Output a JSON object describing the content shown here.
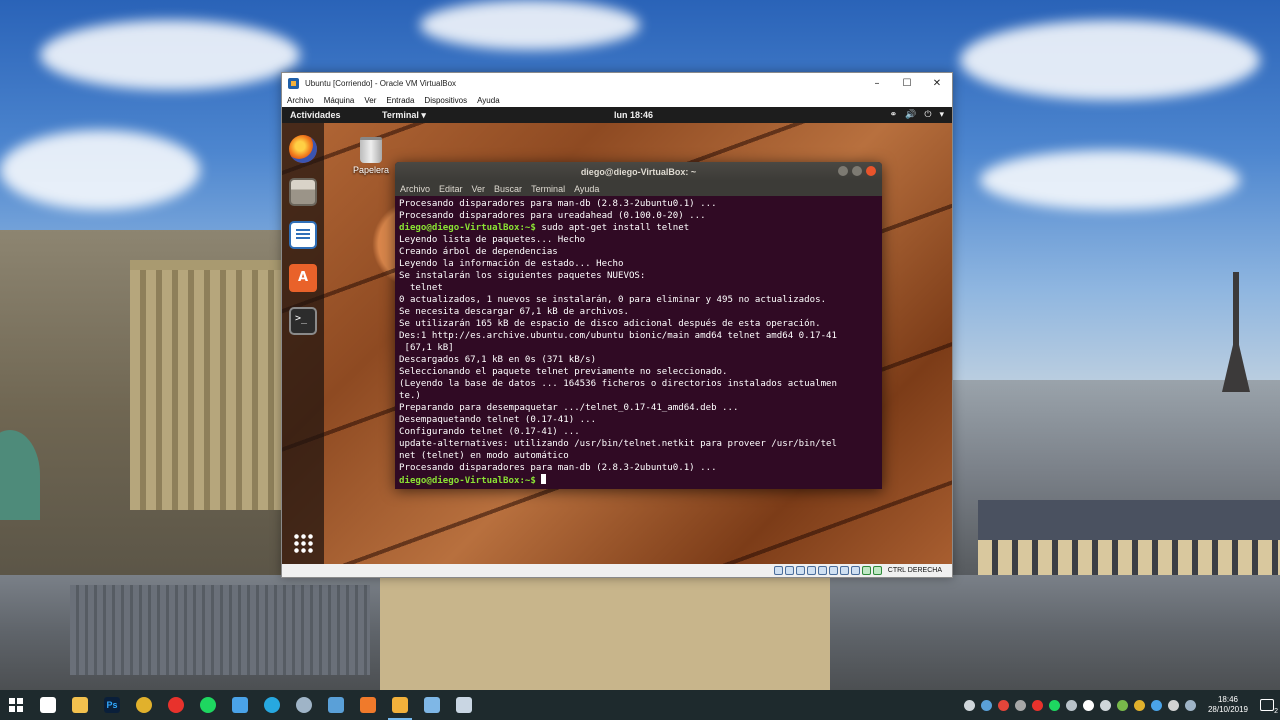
{
  "vbox": {
    "title": "Ubuntu [Corriendo] - Oracle VM VirtualBox",
    "minimize": "–",
    "maximize": "☐",
    "close": "✕",
    "menu": [
      "Archivo",
      "Máquina",
      "Ver",
      "Entrada",
      "Dispositivos",
      "Ayuda"
    ],
    "host_key": "CTRL DERECHA"
  },
  "ubuntu": {
    "activities": "Actividades",
    "app_menu": "Terminal ▾",
    "clock": "lun 18:46",
    "tray": [
      "⚭",
      "🔊",
      "⏻",
      "▾"
    ],
    "trash_label": "Papelera"
  },
  "terminal": {
    "title": "diego@diego-VirtualBox: ~",
    "menu": [
      "Archivo",
      "Editar",
      "Ver",
      "Buscar",
      "Terminal",
      "Ayuda"
    ],
    "prompt": "diego@diego-VirtualBox:~$",
    "lines": [
      {
        "text": "Procesando disparadores para man-db (2.8.3-2ubuntu0.1) ..."
      },
      {
        "text": "Procesando disparadores para ureadahead (0.100.0-20) ..."
      },
      {
        "prompt": true,
        "text": " sudo apt-get install telnet"
      },
      {
        "text": "Leyendo lista de paquetes... Hecho"
      },
      {
        "text": "Creando árbol de dependencias"
      },
      {
        "text": "Leyendo la información de estado... Hecho"
      },
      {
        "text": "Se instalarán los siguientes paquetes NUEVOS:"
      },
      {
        "text": "  telnet"
      },
      {
        "text": "0 actualizados, 1 nuevos se instalarán, 0 para eliminar y 495 no actualizados."
      },
      {
        "text": "Se necesita descargar 67,1 kB de archivos."
      },
      {
        "text": "Se utilizarán 165 kB de espacio de disco adicional después de esta operación."
      },
      {
        "text": "Des:1 http://es.archive.ubuntu.com/ubuntu bionic/main amd64 telnet amd64 0.17-41"
      },
      {
        "text": " [67,1 kB]"
      },
      {
        "text": "Descargados 67,1 kB en 0s (371 kB/s)"
      },
      {
        "text": "Seleccionando el paquete telnet previamente no seleccionado."
      },
      {
        "text": "(Leyendo la base de datos ... 164536 ficheros o directorios instalados actualmen"
      },
      {
        "text": "te.)"
      },
      {
        "text": "Preparando para desempaquetar .../telnet_0.17-41_amd64.deb ..."
      },
      {
        "text": "Desempaquetando telnet (0.17-41) ..."
      },
      {
        "text": "Configurando telnet (0.17-41) ..."
      },
      {
        "text": "update-alternatives: utilizando /usr/bin/telnet.netkit para proveer /usr/bin/tel"
      },
      {
        "text": "net (telnet) en modo automático"
      },
      {
        "text": "Procesando disparadores para man-db (2.8.3-2ubuntu0.1) ..."
      },
      {
        "prompt": true,
        "text": " ",
        "cursor": true
      }
    ]
  },
  "taskbar": {
    "time": "18:46",
    "date": "28/10/2019",
    "notification_count": "2",
    "apps": [
      {
        "name": "task-view-icon",
        "color": "#ffffff"
      },
      {
        "name": "file-explorer-icon",
        "color": "#f2c14e"
      },
      {
        "name": "photoshop-icon",
        "color": "#0a1f3a",
        "label": "Ps"
      },
      {
        "name": "chrome-icon",
        "color": "#e1b12c"
      },
      {
        "name": "opera-icon",
        "color": "#e8322c"
      },
      {
        "name": "spotify-icon",
        "color": "#1ed760"
      },
      {
        "name": "blue-app-icon",
        "color": "#4aa3e8"
      },
      {
        "name": "skype-icon",
        "color": "#27a8e0"
      },
      {
        "name": "steam-icon",
        "color": "#9fb4c7"
      },
      {
        "name": "network-app-icon",
        "color": "#5aa0d8"
      },
      {
        "name": "orange-app-icon",
        "color": "#f07a2b"
      },
      {
        "name": "virtualbox-icon",
        "color": "#f3b13b",
        "active": true
      },
      {
        "name": "notes-app-icon",
        "color": "#7fb7e6"
      },
      {
        "name": "cube-app-icon",
        "color": "#c9d6e3"
      }
    ]
  },
  "colors": {
    "terminal_bg": "#300a24",
    "prompt": "#8ae234",
    "taskbar": "#1e2a2d"
  }
}
